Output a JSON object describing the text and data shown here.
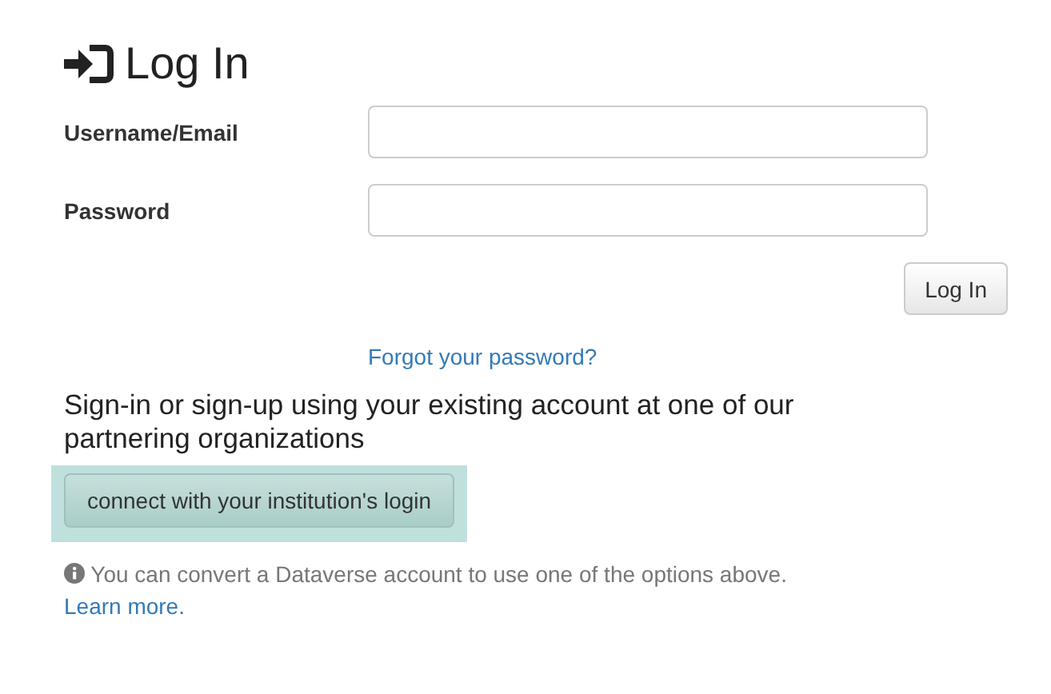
{
  "title": "Log In",
  "fields": [
    {
      "label": "Username/Email"
    },
    {
      "label": "Password"
    }
  ],
  "submit_button": "Log In",
  "forgot_link": "Forgot your password?",
  "partner_heading": "Sign-in or sign-up using your existing account at one of our partnering organizations",
  "institution_button": {
    "label": "connect with your institution's login",
    "highlighted": true
  },
  "info": {
    "text": "You can convert a Dataverse account to use one of the options above.",
    "link": "Learn more."
  }
}
